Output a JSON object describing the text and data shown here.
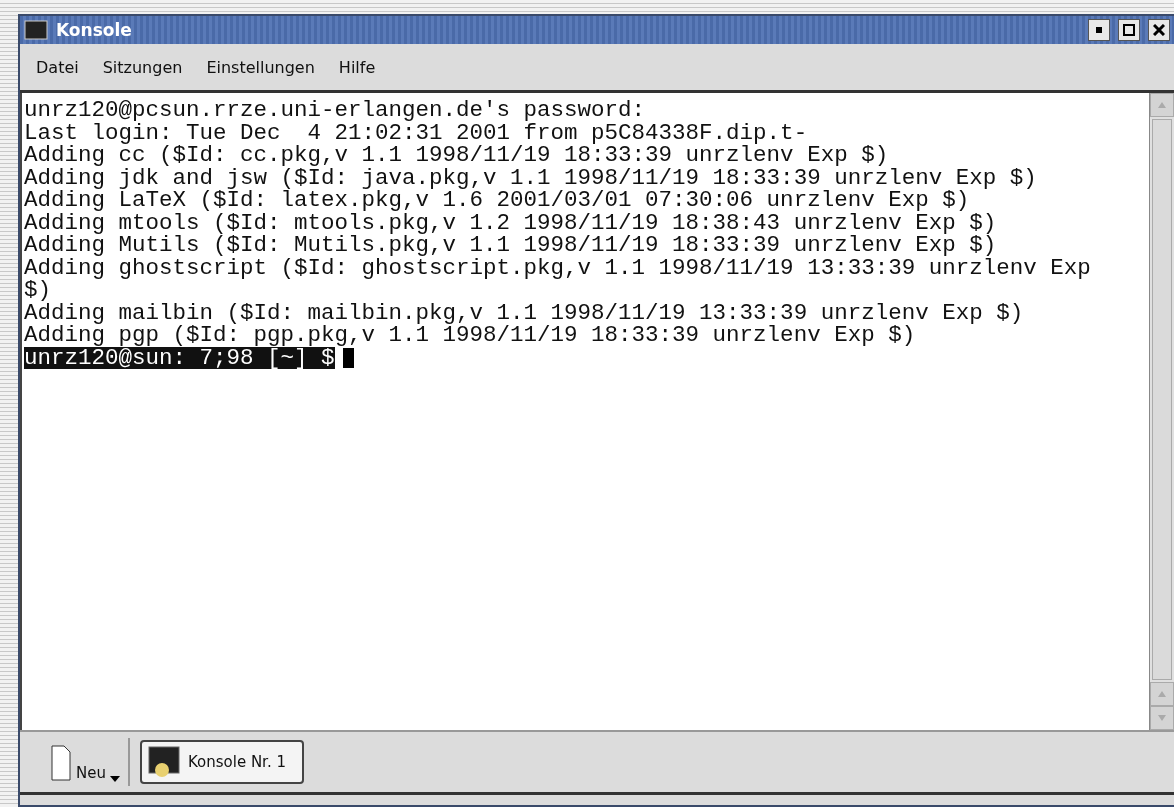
{
  "window": {
    "title": "Konsole"
  },
  "menu": [
    "Datei",
    "Sitzungen",
    "Einstellungen",
    "Hilfe"
  ],
  "terminal": {
    "lines": [
      "unrz120@pcsun.rrze.uni-erlangen.de's password:",
      "Last login: Tue Dec  4 21:02:31 2001 from p5C84338F.dip.t-",
      "Adding cc ($Id: cc.pkg,v 1.1 1998/11/19 18:33:39 unrzlenv Exp $)",
      "Adding jdk and jsw ($Id: java.pkg,v 1.1 1998/11/19 18:33:39 unrzlenv Exp $)",
      "Adding LaTeX ($Id: latex.pkg,v 1.6 2001/03/01 07:30:06 unrzlenv Exp $)",
      "Adding mtools ($Id: mtools.pkg,v 1.2 1998/11/19 18:38:43 unrzlenv Exp $)",
      "Adding Mutils ($Id: Mutils.pkg,v 1.1 1998/11/19 18:33:39 unrzlenv Exp $)",
      "Adding ghostscript ($Id: ghostscript.pkg,v 1.1 1998/11/19 13:33:39 unrzlenv Exp",
      "$)",
      "Adding mailbin ($Id: mailbin.pkg,v 1.1 1998/11/19 13:33:39 unrzlenv Exp $)",
      "Adding pgp ($Id: pgp.pkg,v 1.1 1998/11/19 18:33:39 unrzlenv Exp $)"
    ],
    "prompt": "unrz120@sun: 7;98 [~] $"
  },
  "taskbar": {
    "new_button": "Neu",
    "tabs": [
      {
        "label": "Konsole Nr. 1",
        "selected": true
      }
    ]
  }
}
